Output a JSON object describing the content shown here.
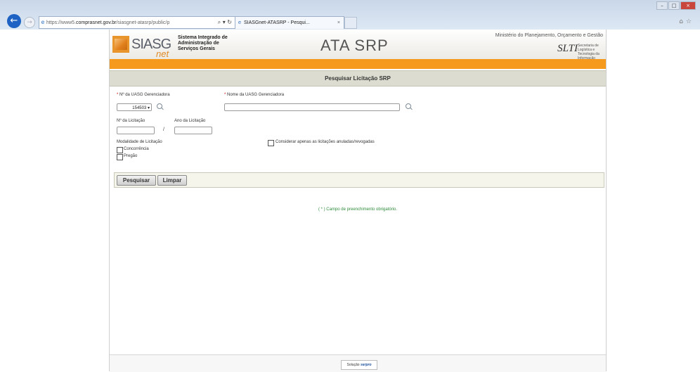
{
  "browser": {
    "address_prefix": "https://www5.",
    "address_host": "comprasnet.gov.br",
    "address_path": "/siasgnet-atasrp/public/p",
    "address_tools": "⌕ ▾ ↻",
    "tab_title": "SIASGnet-ATASRP - Pesqui...",
    "tab_close": "×",
    "back_glyph": "←",
    "forward_glyph": "→",
    "icons": [
      "back-arrow-icon",
      "forward-arrow-icon",
      "ie-page-icon",
      "close-icon"
    ]
  },
  "header": {
    "logo_text": "SIASG",
    "logo_net": "net",
    "system_name_1": "Sistema Integrado de",
    "system_name_2": "Administração de",
    "system_name_3": "Serviços Gerais",
    "title": "ATA SRP",
    "ministry": "Ministério do Planejamento, Orçamento e Gestão",
    "slti_logo": "SLTI",
    "slti_sub": "Secretaria de Logística e Tecnologia da Informação"
  },
  "section": {
    "title": "Pesquisar Licitação SRP"
  },
  "form": {
    "required_mark": "* ",
    "uasg_num_label": "Nº da UASG Gerenciadora",
    "uasg_num_value": "154503",
    "uasg_name_label": "Nome da UASG Gerenciadora",
    "uasg_name_value": "",
    "licitacao_num_label": "Nº da Licitação",
    "licitacao_num_value": "",
    "separator": "/",
    "licitacao_year_label": "Ano da Licitação",
    "licitacao_year_value": "",
    "modalidade_label": "Modalidade de Licitação",
    "modalidade_options": [
      "Concorrência",
      "Pregão"
    ],
    "only_annulled_label": "Considerar apenas as licitações anuladas/revogadas"
  },
  "buttons": {
    "search": "Pesquisar",
    "clear": "Limpar"
  },
  "messages": {
    "required_note": "( * ) Campo de preenchimento obrigatório."
  },
  "footer": {
    "badge_prefix": "Solução",
    "badge_brand": "serpro"
  },
  "colors": {
    "accent_orange": "#f59a1c",
    "section_bar": "#dcdcd0",
    "required_note_green": "#2e8b3a",
    "browser_back_blue": "#1e63c4"
  }
}
